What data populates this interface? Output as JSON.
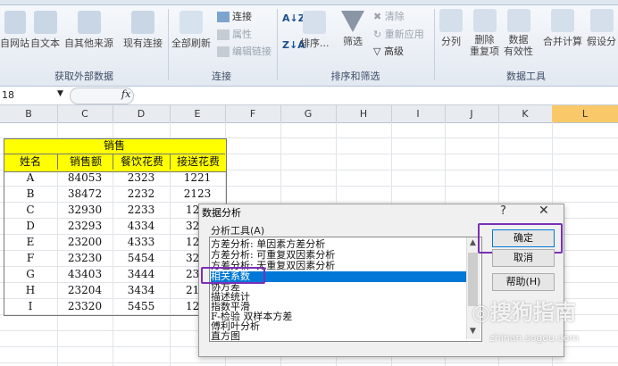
{
  "ribbon": {
    "get_external": {
      "buttons": [
        "自网站",
        "自文本",
        "自其他来源",
        "现有连接"
      ],
      "label": "获取外部数据"
    },
    "connections": {
      "refresh_all": "全部刷新",
      "links": [
        "连接",
        "属性",
        "编辑链接"
      ],
      "label": "连接"
    },
    "sort_filter": {
      "sort": "排序...",
      "filter": "筛选",
      "clear": "清除",
      "reapply": "重新应用",
      "advanced": "高级",
      "label": "排序和筛选"
    },
    "data_tools": {
      "split": "分列",
      "remove_dup": [
        "删除",
        "重复项"
      ],
      "validation": [
        "数据",
        "有效性"
      ],
      "consolidate": "合并计算",
      "whatif": "假设分",
      "label": "数据工具"
    }
  },
  "formula_bar": {
    "name_box": "18",
    "fx": "fx"
  },
  "sheet": {
    "columns": [
      "B",
      "C",
      "D",
      "E",
      "F",
      "G",
      "H",
      "I",
      "J",
      "K",
      "L"
    ],
    "selected_column": "L",
    "merged_header": "销售",
    "headers": [
      "姓名",
      "销售额",
      "餐饮花费",
      "接送花费"
    ],
    "rows": [
      [
        "A",
        "84053",
        "2323",
        "1221"
      ],
      [
        "B",
        "38472",
        "2232",
        "2123"
      ],
      [
        "C",
        "32930",
        "2233",
        "12"
      ],
      [
        "D",
        "23293",
        "4334",
        "32"
      ],
      [
        "E",
        "23200",
        "4333",
        "12"
      ],
      [
        "F",
        "23230",
        "5454",
        "32"
      ],
      [
        "G",
        "43403",
        "3444",
        "23"
      ],
      [
        "H",
        "23204",
        "3434",
        "21"
      ],
      [
        "I",
        "23320",
        "5455",
        "12"
      ]
    ]
  },
  "dialog": {
    "title": "数据分析",
    "help_mark": "?",
    "close_mark": "✕",
    "tools_label": "分析工具(A)",
    "items": [
      "方差分析: 单因素方差分析",
      "方差分析: 可重复双因素分析",
      "方差分析: 无重复双因素分析",
      "相关系数",
      "协方差",
      "描述统计",
      "指数平滑",
      "F-检验 双样本方差",
      "傅利叶分析",
      "直方图"
    ],
    "selected_index": 3,
    "ok": "确定",
    "cancel": "取消",
    "help": "帮助(H)"
  },
  "watermark": {
    "brand": "搜狗指南",
    "url": "zhinan.sogou.com"
  },
  "colors": {
    "highlight_purple": "#7b2fb8",
    "selection_blue": "#0078d7",
    "header_yellow": "#ffff00"
  }
}
